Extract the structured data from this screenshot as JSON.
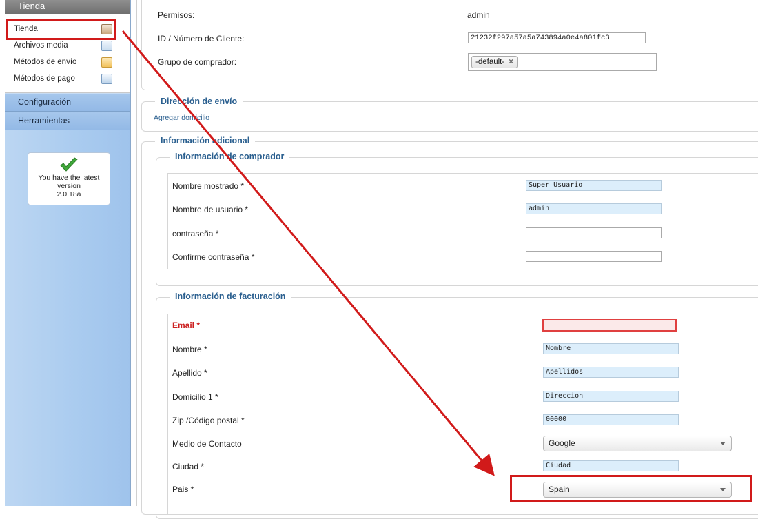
{
  "sidebar": {
    "header": "Tienda",
    "items": [
      {
        "label": "Tienda",
        "icon": "user-icon"
      },
      {
        "label": "Archivos media",
        "icon": "media-icon"
      },
      {
        "label": "Métodos de envío",
        "icon": "truck-icon"
      },
      {
        "label": "Métodos de pago",
        "icon": "payment-icon"
      }
    ],
    "sections": [
      "Configuración",
      "Herramientas"
    ],
    "version": {
      "line1": "You have the latest",
      "line2": "version",
      "line3": "2.0.18a"
    }
  },
  "account": {
    "permisos_label": "Permisos:",
    "permisos_value": "admin",
    "id_label": "ID / Número de Cliente:",
    "id_value": "21232f297a57a5a743894a0e4a801fc3",
    "grupo_label": "Grupo de comprador:",
    "grupo_tag": "-default-",
    "tag_remove": "×"
  },
  "shipping": {
    "legend": "Dirección de envío",
    "add_link": "Agregar domicilio"
  },
  "additional": {
    "legend": "Información adicional",
    "buyer": {
      "legend": "Información de comprador",
      "fields": [
        {
          "label": "Nombre mostrado *",
          "value": "Super Usuario"
        },
        {
          "label": "Nombre de usuario *",
          "value": "admin"
        },
        {
          "label": "contraseña *",
          "value": ""
        },
        {
          "label": "Confirme contraseña *",
          "value": ""
        }
      ]
    },
    "billing": {
      "legend": "Información de facturación",
      "fields": [
        {
          "label": "Email *",
          "value": ""
        },
        {
          "label": "Nombre *",
          "value": "Nombre"
        },
        {
          "label": "Apellido *",
          "value": "Apellidos"
        },
        {
          "label": "Domicilio 1 *",
          "value": "Direccion"
        },
        {
          "label": "Zip /Código postal *",
          "value": "00000"
        },
        {
          "label": "Medio de Contacto",
          "value": "Google"
        },
        {
          "label": "Ciudad *",
          "value": "Ciudad"
        },
        {
          "label": "Pais *",
          "value": "Spain"
        }
      ]
    }
  },
  "colors": {
    "annotation": "#d11a1a",
    "legend": "#2a5f8f",
    "error": "#cc2020"
  }
}
